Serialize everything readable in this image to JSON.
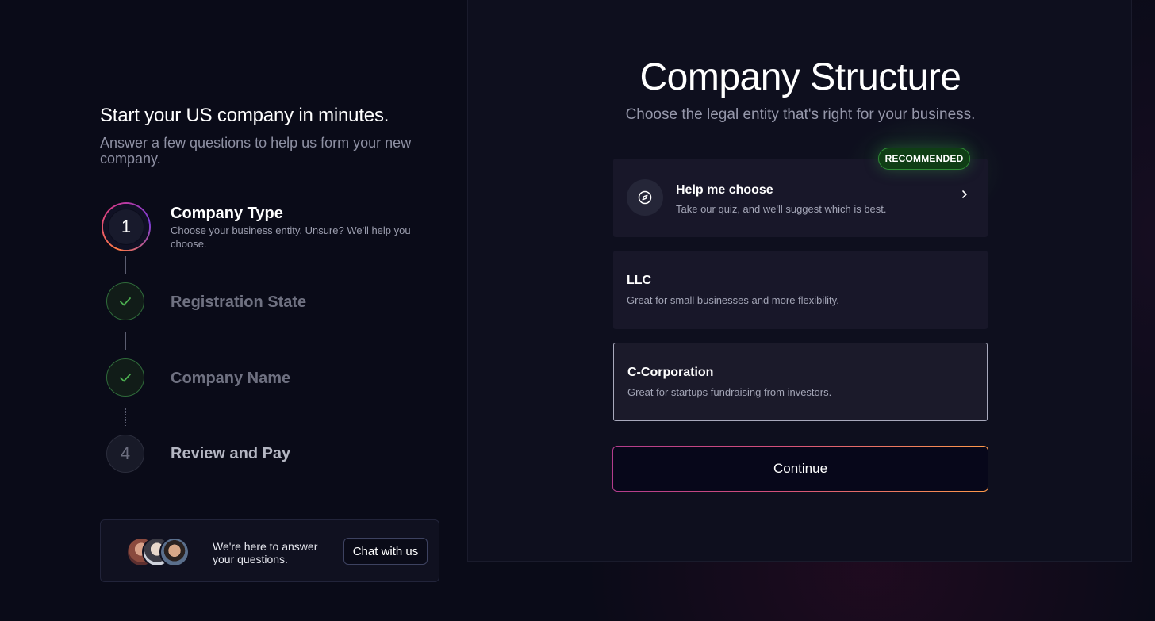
{
  "sidebar": {
    "title": "Start your US company in minutes.",
    "subtitle": "Answer a few questions to help us form your new company.",
    "steps": [
      {
        "indicator": "1",
        "state": "active",
        "title": "Company Type",
        "description": "Choose your business entity. Unsure? We'll help you choose."
      },
      {
        "indicator": "check-icon",
        "state": "completed",
        "title": "Registration State"
      },
      {
        "indicator": "check-icon",
        "state": "completed",
        "title": "Company Name"
      },
      {
        "indicator": "4",
        "state": "pending",
        "title": "Review and Pay"
      }
    ],
    "help": {
      "text": "We're here to answer your questions.",
      "button": "Chat with us"
    }
  },
  "main": {
    "title": "Company Structure",
    "subtitle": "Choose the legal entity that's right for your business.",
    "options": [
      {
        "title": "Help me choose",
        "description": "Take our quiz, and we'll suggest which is best.",
        "badge": "RECOMMENDED",
        "icon": "compass-icon",
        "selected": false
      },
      {
        "title": "LLC",
        "description": "Great for small businesses and more flexibility.",
        "selected": false
      },
      {
        "title": "C-Corporation",
        "description": "Great for startups fundraising from investors.",
        "selected": true
      }
    ],
    "continue_label": "Continue"
  },
  "colors": {
    "background": "#0a0b18",
    "panel": "#0e0f1e",
    "card": "#181729",
    "badge_green": "#0f3d15",
    "accent_orange": "#ff9a4a",
    "accent_pink": "#b23c8c",
    "check_green": "#4caf50"
  }
}
